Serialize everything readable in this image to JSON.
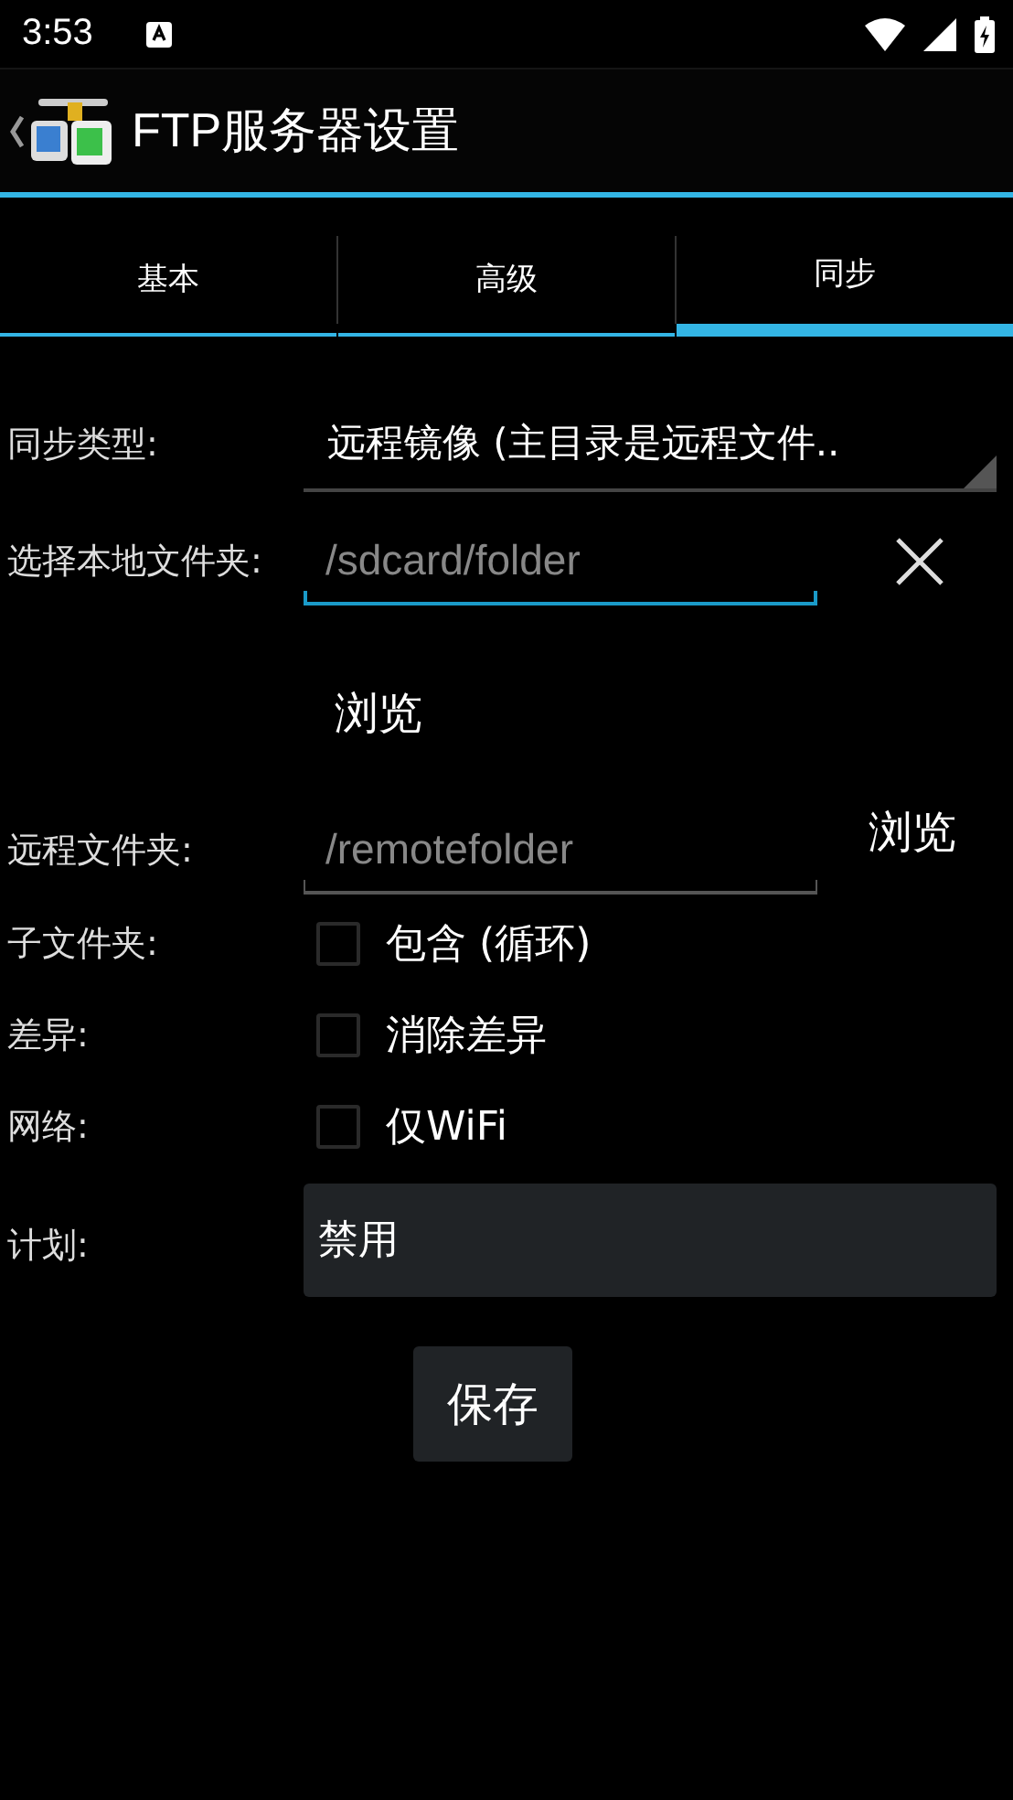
{
  "status_bar": {
    "time": "3:53"
  },
  "app_bar": {
    "title": "FTP服务器设置"
  },
  "tabs": [
    {
      "label": "基本",
      "selected": false
    },
    {
      "label": "高级",
      "selected": false
    },
    {
      "label": "同步",
      "selected": true
    }
  ],
  "form": {
    "sync_type": {
      "label": "同步类型:",
      "value": "远程镜像 (主目录是远程文件.."
    },
    "local_folder": {
      "label": "选择本地文件夹:",
      "placeholder": "/sdcard/folder",
      "focused": true,
      "browse": "浏览"
    },
    "remote_folder": {
      "label": "远程文件夹:",
      "placeholder": "/remotefolder",
      "focused": false,
      "browse": "浏览"
    },
    "options": [
      {
        "label": "子文件夹:",
        "text": "包含 (循环)",
        "checked": false
      },
      {
        "label": "差异:",
        "text": "消除差异",
        "checked": false
      },
      {
        "label": "网络:",
        "text": "仅WiFi",
        "checked": false
      }
    ],
    "schedule": {
      "label": "计划:",
      "value": "禁用"
    },
    "save": "保存"
  }
}
